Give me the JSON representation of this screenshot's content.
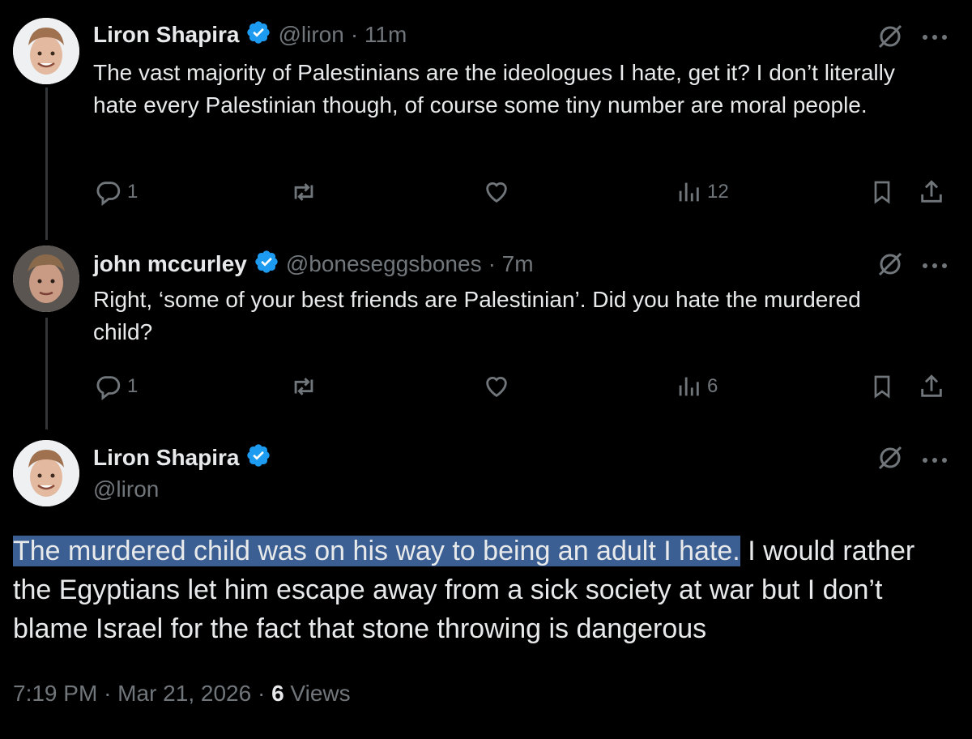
{
  "colors": {
    "background": "#000000",
    "text": "#e7e9ea",
    "muted": "#71767b",
    "verified": "#1d9bf0",
    "highlight": "#3b5f92",
    "thread_line": "#333639"
  },
  "replies": [
    {
      "author_name": "Liron Shapira",
      "handle": "@liron",
      "time": "· 11m",
      "text": "The vast majority of Palestinians are the ideologues I hate, get it? I don’t literally hate every Palestinian though, of course some tiny number are moral people.",
      "reply_count": "1",
      "views": "12"
    },
    {
      "author_name": "john mccurley",
      "handle": "@boneseggsbones",
      "time": "· 7m",
      "text": "Right, ‘some of your best friends are Palestinian’. Did you hate the murdered child?",
      "reply_count": "1",
      "views": "6"
    }
  ],
  "main_post": {
    "author_name": "Liron Shapira",
    "handle": "@liron",
    "highlighted_text": "The murdered child was on his way to being an adult I hate.",
    "text_rest": " I would rather the Egyptians let him escape away from a sick society at war but I don’t blame Israel for the fact that stone throwing is dangerous",
    "time": "7:19 PM",
    "date": "Mar 21, 2026",
    "views_count": "6",
    "views_label": "Views"
  },
  "icons": {
    "more": "more-horizontal-icon",
    "grok": "grok-icon",
    "reply": "reply-icon",
    "repost": "repost-icon",
    "like": "like-icon",
    "views": "views-icon",
    "bookmark": "bookmark-icon",
    "share": "share-icon",
    "verified": "verified-badge-icon"
  }
}
